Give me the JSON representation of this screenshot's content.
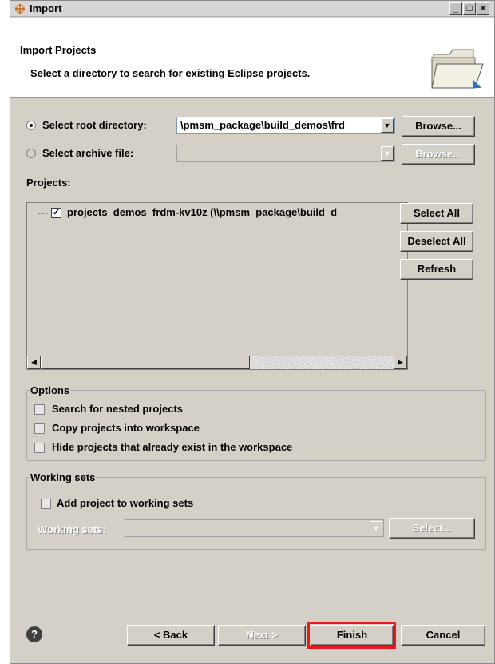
{
  "window": {
    "title": "Import",
    "controls": [
      "_",
      "□",
      "×"
    ]
  },
  "header": {
    "title": "Import Projects",
    "description": "Select a directory to search for existing Eclipse projects.",
    "icon": "open-folder-icon"
  },
  "source": {
    "root_label": "Select root directory:",
    "root_value": "\\pmsm_package\\build_demos\\frd",
    "root_selected": true,
    "archive_label": "Select archive file:",
    "archive_value": "",
    "browse_label": "Browse..."
  },
  "projects": {
    "label": "Projects:",
    "items": [
      {
        "label": "projects_demos_frdm-kv10z (\\\\pmsm_package\\build_d",
        "checked": true
      }
    ],
    "select_all": "Select All",
    "deselect_all": "Deselect All",
    "refresh": "Refresh"
  },
  "options": {
    "legend": "Options",
    "items": [
      {
        "label": "Search for nested projects",
        "checked": false
      },
      {
        "label": "Copy projects into workspace",
        "checked": false
      },
      {
        "label": "Hide projects that already exist in the workspace",
        "checked": false
      }
    ]
  },
  "working_sets": {
    "legend": "Working sets",
    "add_label": "Add project to working sets",
    "add_checked": false,
    "field_label": "Working sets:",
    "field_value": "",
    "select_label": "Select..."
  },
  "footer": {
    "help": "?",
    "back": "< Back",
    "next": "Next >",
    "finish": "Finish",
    "cancel": "Cancel",
    "highlight_color": "#e8191f"
  }
}
